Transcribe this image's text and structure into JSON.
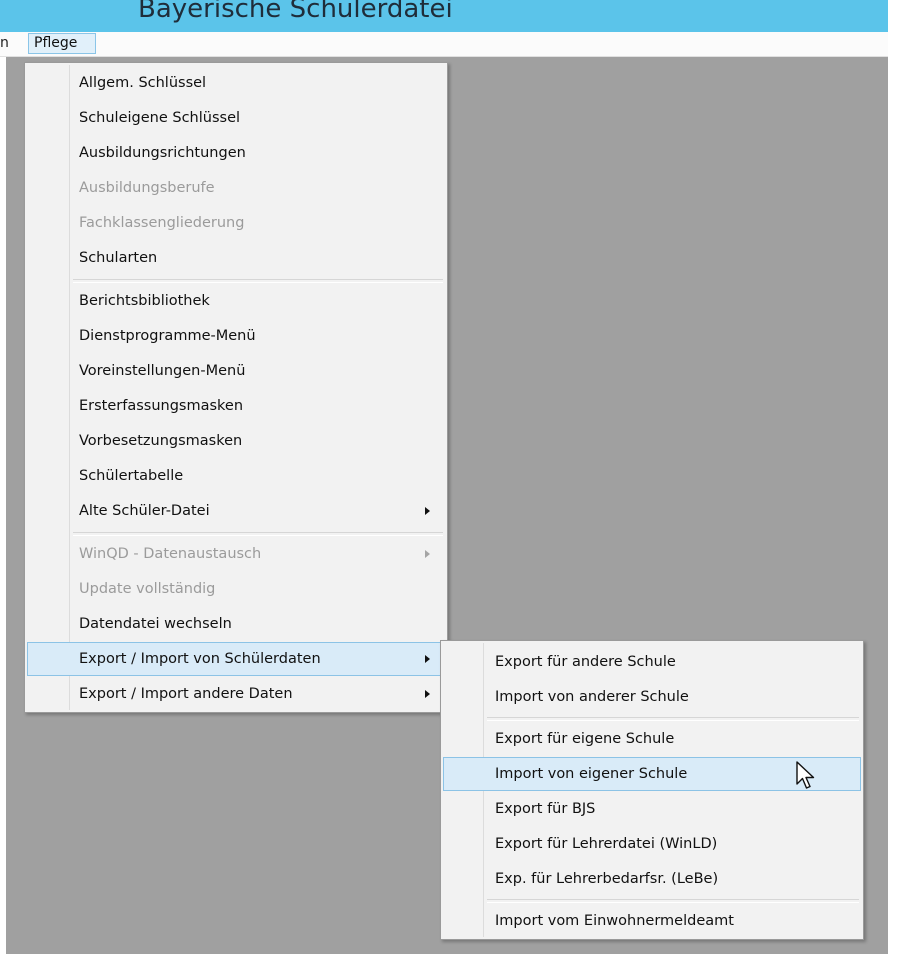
{
  "window": {
    "title": "Bayerische Schülerdatei"
  },
  "menubar": {
    "cut_item": "n",
    "active_menu": "Pflege"
  },
  "pflege_menu": {
    "items": [
      {
        "label": "Allgem. Schlüssel",
        "enabled": true
      },
      {
        "label": "Schuleigene Schlüssel",
        "enabled": true
      },
      {
        "label": "Ausbildungsrichtungen",
        "enabled": true
      },
      {
        "label": "Ausbildungsberufe",
        "enabled": false
      },
      {
        "label": "Fachklassengliederung",
        "enabled": false
      },
      {
        "label": "Schularten",
        "enabled": true
      },
      {
        "label": "Berichtsbibliothek",
        "enabled": true
      },
      {
        "label": "Dienstprogramme-Menü",
        "enabled": true
      },
      {
        "label": "Voreinstellungen-Menü",
        "enabled": true
      },
      {
        "label": "Ersterfassungsmasken",
        "enabled": true
      },
      {
        "label": "Vorbesetzungsmasken",
        "enabled": true
      },
      {
        "label": "Schülertabelle",
        "enabled": true
      },
      {
        "label": "Alte Schüler-Datei",
        "enabled": true,
        "submenu": true
      },
      {
        "label": "WinQD - Datenaustausch",
        "enabled": false,
        "submenu": true
      },
      {
        "label": "Update vollständig",
        "enabled": false
      },
      {
        "label": "Datendatei wechseln",
        "enabled": true
      },
      {
        "label": "Export / Import von Schülerdaten",
        "enabled": true,
        "submenu": true,
        "highlighted": true
      },
      {
        "label": "Export / Import andere Daten",
        "enabled": true,
        "submenu": true
      }
    ]
  },
  "export_submenu": {
    "items": [
      {
        "label": "Export für andere Schule"
      },
      {
        "label": "Import von anderer Schule"
      },
      {
        "label": "Export für eigene Schule"
      },
      {
        "label": "Import von eigener Schule",
        "highlighted": true
      },
      {
        "label": "Export für BJS"
      },
      {
        "label": "Export für Lehrerdatei (WinLD)"
      },
      {
        "label": "Exp. für Lehrerbedarfsr. (LeBe)"
      },
      {
        "label": "Import vom Einwohnermeldeamt"
      }
    ]
  },
  "colors": {
    "titlebar": "#5bc4ea",
    "workspace": "#a0a0a0",
    "menu_background": "#f2f2f2",
    "highlight": "#d9ebf8",
    "highlight_border": "#8cc3e6",
    "disabled_text": "#9b9b9b"
  },
  "icons": {
    "submenu_arrow": "triangle-right",
    "cursor": "mouse-pointer-arrow"
  }
}
